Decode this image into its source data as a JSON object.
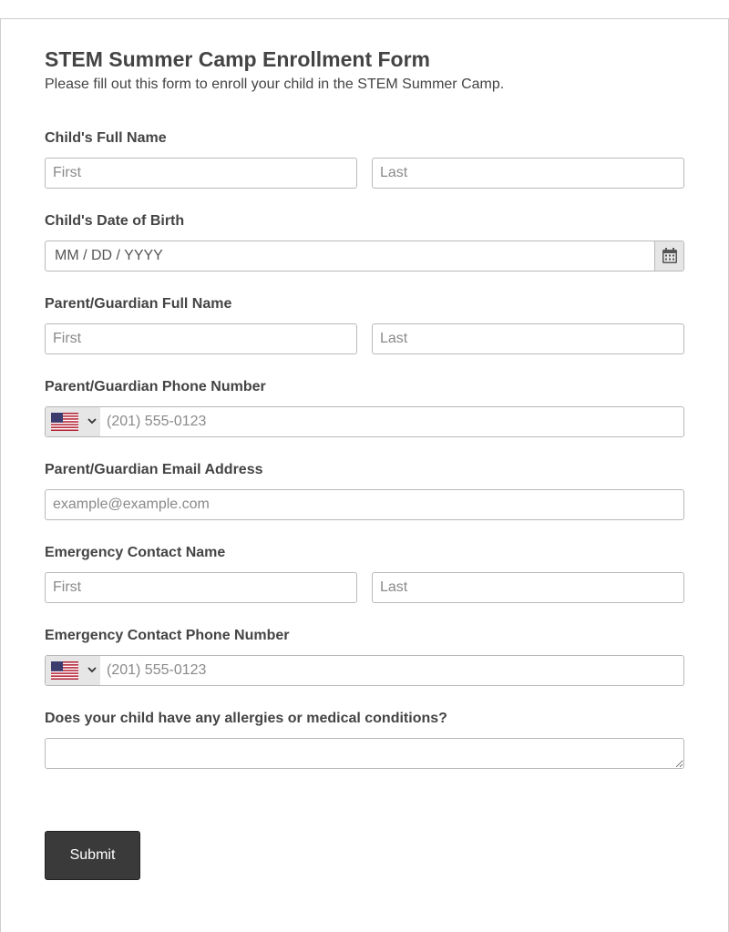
{
  "form": {
    "title": "STEM Summer Camp Enrollment Form",
    "subtitle": "Please fill out this form to enroll your child in the STEM Summer Camp."
  },
  "child_name": {
    "label": "Child's Full Name",
    "first_placeholder": "First",
    "last_placeholder": "Last"
  },
  "child_dob": {
    "label": "Child's Date of Birth",
    "placeholder": "MM / DD / YYYY"
  },
  "parent_name": {
    "label": "Parent/Guardian Full Name",
    "first_placeholder": "First",
    "last_placeholder": "Last"
  },
  "parent_phone": {
    "label": "Parent/Guardian Phone Number",
    "country_flag": "us-flag-icon",
    "placeholder": "(201) 555-0123"
  },
  "parent_email": {
    "label": "Parent/Guardian Email Address",
    "placeholder": "example@example.com"
  },
  "emergency_name": {
    "label": "Emergency Contact Name",
    "first_placeholder": "First",
    "last_placeholder": "Last"
  },
  "emergency_phone": {
    "label": "Emergency Contact Phone Number",
    "country_flag": "us-flag-icon",
    "placeholder": "(201) 555-0123"
  },
  "medical": {
    "label": "Does your child have any allergies or medical conditions?"
  },
  "submit": {
    "label": "Submit"
  },
  "colors": {
    "button_bg": "#3a3a3a",
    "text": "#444444",
    "border": "#b8b8b8",
    "addon_bg": "#e6e6e6"
  }
}
